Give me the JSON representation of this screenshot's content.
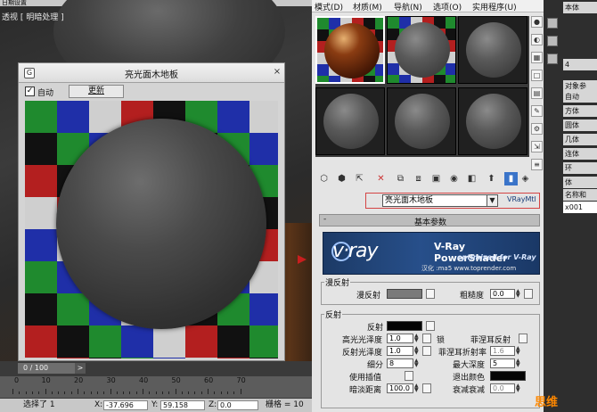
{
  "viewport": {
    "title_strip": "日期设置",
    "label": "透视 [ 明暗处理 ]"
  },
  "preview_window": {
    "title": "亮光面木地板",
    "close_label": "×",
    "app_icon": "G",
    "auto_check": "✓",
    "auto_label": "自动",
    "update_label": "更新"
  },
  "timeline": {
    "frame_counter": "0 / 100",
    "next_label": ">",
    "ticks": [
      "0",
      "10",
      "20",
      "30",
      "40",
      "50",
      "60",
      "70"
    ],
    "status": {
      "selected": "选择了 1",
      "x_label": "X:",
      "x_value": "-37.696",
      "y_label": "Y:",
      "y_value": "59.158",
      "z_label": "Z:",
      "z_value": "0.0",
      "grid_label": "栅格 = 10"
    }
  },
  "menu": {
    "items": [
      "模式(D)",
      "材质(M)",
      "导航(N)",
      "选项(O)",
      "实用程序(U)"
    ]
  },
  "material": {
    "name": "亮光面木地板",
    "type": "VRayMtl",
    "rollout_title": "基本参数",
    "rollout_toggle": "-"
  },
  "banner": {
    "logo": "v·ray",
    "title": "V-Ray PowerShader",
    "subtitle": "optimized for V-Ray",
    "credit": "汉化 :ma5  www.toprender.com"
  },
  "diffuse_group": {
    "title": "漫反射",
    "diffuse_label": "漫反射",
    "roughness_label": "粗糙度",
    "roughness_value": "0.0"
  },
  "reflection_group": {
    "title": "反射",
    "reflect_label": "反射",
    "hilight_gloss_label": "高光光泽度",
    "hilight_gloss_value": "1.0",
    "lock_label": "锁",
    "fresnel_label": "菲涅耳反射",
    "refl_gloss_label": "反射光泽度",
    "refl_gloss_value": "1.0",
    "fresnel_ior_label": "菲涅耳折射率",
    "fresnel_ior_value": "1.6",
    "subdivs_label": "细分",
    "subdivs_value": "8",
    "max_depth_label": "最大深度",
    "max_depth_value": "5",
    "interp_label": "使用插值",
    "exit_color_label": "退出颜色",
    "dim_dist_label": "暗淡距离",
    "dim_dist_value": "100.0",
    "dim_falloff_label": "衰减衰减",
    "dim_falloff_value": "0.0"
  },
  "cmd_panel": {
    "rows": [
      "4",
      "对象参",
      "自动",
      "方体",
      "圆体",
      "几体",
      "连体",
      "环",
      "体",
      "名称和",
      "x001"
    ],
    "top_row": "本体"
  },
  "watermark": "思维",
  "colors": {
    "accent_red": "#d44444",
    "vray_blue": "#274f8a",
    "reflect_swatch": "#050505",
    "diffuse_swatch": "#7a7a7a"
  }
}
